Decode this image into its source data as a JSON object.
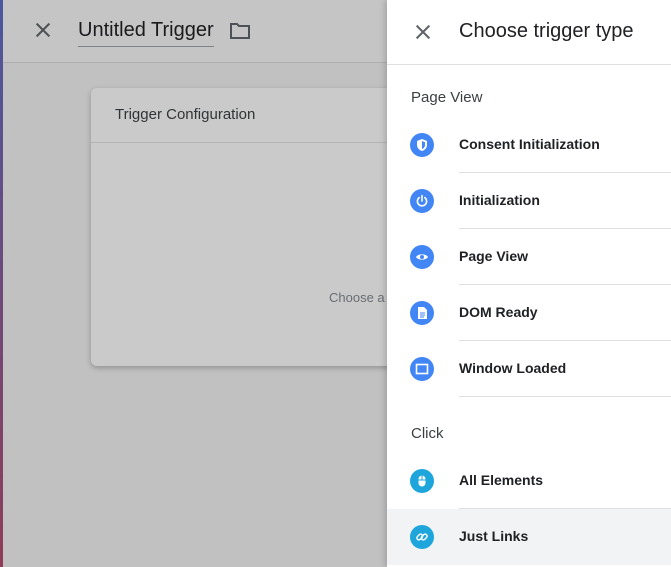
{
  "editor": {
    "trigger_name": "Untitled Trigger",
    "config_title": "Trigger Configuration",
    "config_hint": "Choose a"
  },
  "panel": {
    "title": "Choose trigger type",
    "sections": [
      {
        "title": "Page View",
        "items": [
          {
            "label": "Consent Initialization",
            "icon": "shield-icon"
          },
          {
            "label": "Initialization",
            "icon": "power-icon"
          },
          {
            "label": "Page View",
            "icon": "eye-icon"
          },
          {
            "label": "DOM Ready",
            "icon": "document-icon"
          },
          {
            "label": "Window Loaded",
            "icon": "window-icon"
          }
        ]
      },
      {
        "title": "Click",
        "items": [
          {
            "label": "All Elements",
            "icon": "mouse-icon"
          },
          {
            "label": "Just Links",
            "icon": "link-icon"
          }
        ]
      }
    ]
  },
  "colors": {
    "page_view_icon": "#4285f4",
    "click_icon": "#1ea5dc",
    "selected_row": "#f1f3f4"
  }
}
